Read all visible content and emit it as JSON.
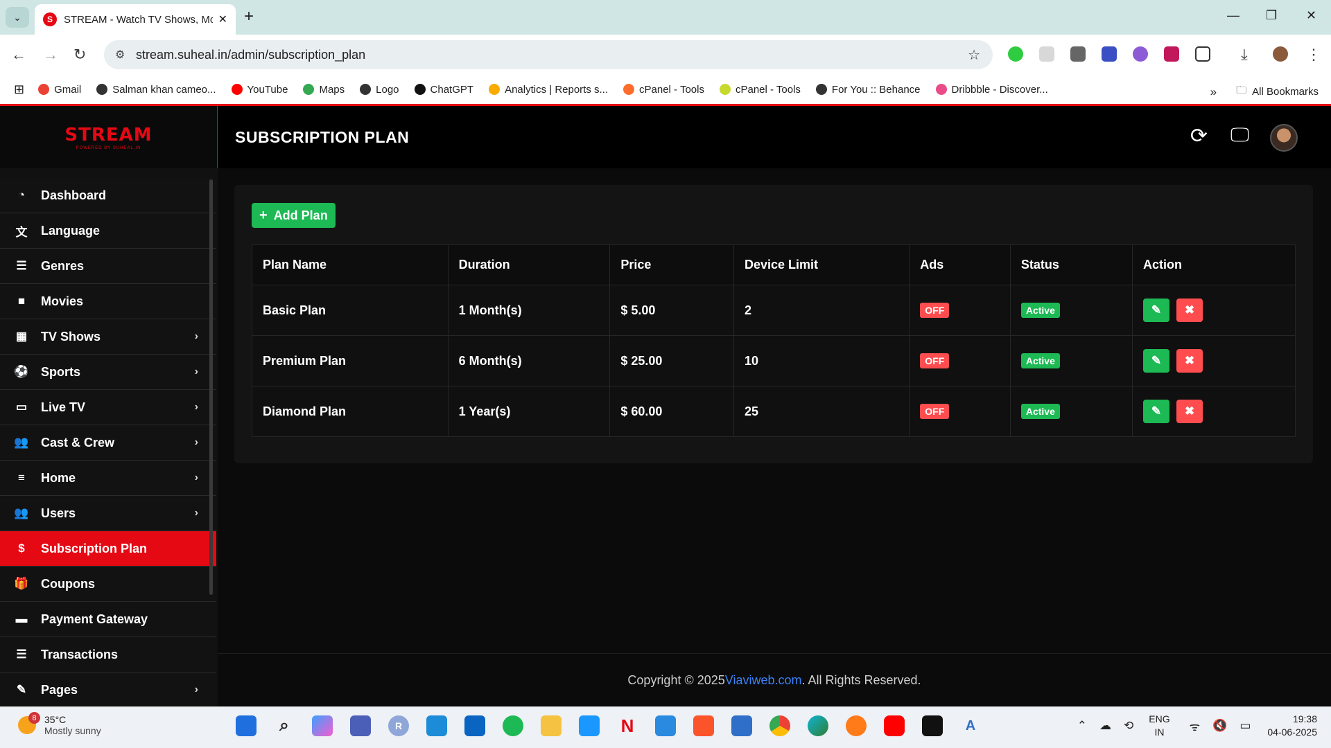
{
  "browser": {
    "tab_title": "STREAM - Watch TV Shows, Mo",
    "url": "stream.suheal.in/admin/subscription_plan",
    "bookmarks": [
      {
        "label": "Gmail",
        "color": "#ea4335"
      },
      {
        "label": "Salman khan cameo...",
        "color": "#333333"
      },
      {
        "label": "YouTube",
        "color": "#ff0000"
      },
      {
        "label": "Maps",
        "color": "#34a853"
      },
      {
        "label": "Logo",
        "color": "#333333"
      },
      {
        "label": "ChatGPT",
        "color": "#111111"
      },
      {
        "label": "Analytics | Reports s...",
        "color": "#f9ab00"
      },
      {
        "label": "cPanel - Tools",
        "color": "#ff6c2c"
      },
      {
        "label": "cPanel - Tools",
        "color": "#c6d92c"
      },
      {
        "label": "For You :: Behance",
        "color": "#333333"
      },
      {
        "label": "Dribbble - Discover...",
        "color": "#ea4c89"
      }
    ],
    "all_bookmarks": "All Bookmarks"
  },
  "app": {
    "logo": "STREAM",
    "logo_sub": "POWERED BY SUHEAL.IN",
    "page_title": "SUBSCRIPTION PLAN",
    "accent": "#e50914",
    "success": "#1db954",
    "danger": "#ff4d4f"
  },
  "sidebar": {
    "items": [
      {
        "label": "Dashboard",
        "icon": "dashboard-icon",
        "chevron": false
      },
      {
        "label": "Language",
        "icon": "language-icon",
        "chevron": false
      },
      {
        "label": "Genres",
        "icon": "list-icon",
        "chevron": false
      },
      {
        "label": "Movies",
        "icon": "video-camera-icon",
        "chevron": false
      },
      {
        "label": "TV Shows",
        "icon": "film-icon",
        "chevron": true
      },
      {
        "label": "Sports",
        "icon": "soccer-ball-icon",
        "chevron": true
      },
      {
        "label": "Live TV",
        "icon": "monitor-icon",
        "chevron": true
      },
      {
        "label": "Cast & Crew",
        "icon": "users-icon",
        "chevron": true
      },
      {
        "label": "Home",
        "icon": "sliders-icon",
        "chevron": true
      },
      {
        "label": "Users",
        "icon": "users-icon",
        "chevron": true
      },
      {
        "label": "Subscription Plan",
        "icon": "dollar-icon",
        "chevron": false
      },
      {
        "label": "Coupons",
        "icon": "gift-icon",
        "chevron": false
      },
      {
        "label": "Payment Gateway",
        "icon": "credit-card-icon",
        "chevron": false
      },
      {
        "label": "Transactions",
        "icon": "list-icon",
        "chevron": false
      },
      {
        "label": "Pages",
        "icon": "edit-icon",
        "chevron": true
      }
    ]
  },
  "main": {
    "add_button": "Add Plan",
    "columns": [
      "Plan Name",
      "Duration",
      "Price",
      "Device Limit",
      "Ads",
      "Status",
      "Action"
    ],
    "rows": [
      {
        "name": "Basic Plan",
        "duration": "1 Month(s)",
        "price": "$ 5.00",
        "devices": "2",
        "ads": "OFF",
        "status": "Active"
      },
      {
        "name": "Premium Plan",
        "duration": "6 Month(s)",
        "price": "$ 25.00",
        "devices": "10",
        "ads": "OFF",
        "status": "Active"
      },
      {
        "name": "Diamond Plan",
        "duration": "1 Year(s)",
        "price": "$ 60.00",
        "devices": "25",
        "ads": "OFF",
        "status": "Active"
      }
    ]
  },
  "footer": {
    "prefix": "Copyright © 2025 ",
    "link": "Viaviweb.com",
    "suffix": ". All Rights Reserved."
  },
  "taskbar": {
    "weather_temp": "35°C",
    "weather_desc": "Mostly sunny",
    "weather_badge": "8",
    "lang_top": "ENG",
    "lang_bottom": "IN",
    "time": "19:38",
    "date": "04-06-2025"
  }
}
